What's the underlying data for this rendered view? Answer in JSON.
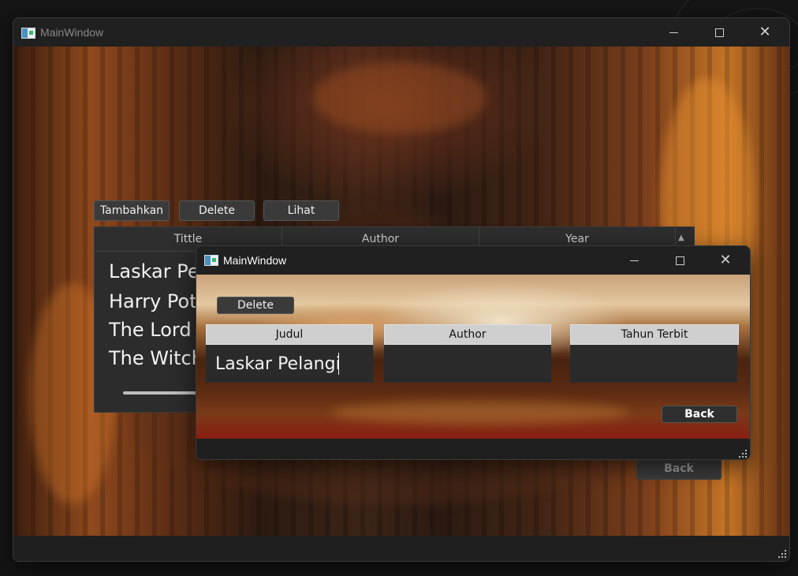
{
  "main_window": {
    "title": "MainWindow",
    "toolbar": {
      "add_label": "Tambahkan",
      "delete_label": "Delete",
      "view_label": "Lihat"
    },
    "table": {
      "headers": [
        "Tittle",
        "Author",
        "Year"
      ],
      "rows": [
        "Laskar Pelangi",
        "Harry Potter",
        "The Lord of the Rings",
        "The Witcher"
      ]
    },
    "back_label": "Back"
  },
  "dialog_window": {
    "title": "MainWindow",
    "delete_label": "Delete",
    "headers": [
      "Judul",
      "Author",
      "Tahun Terbit"
    ],
    "values": {
      "judul": "Laskar Pelangi",
      "author": "",
      "tahun_terbit": ""
    },
    "back_label": "Back"
  },
  "icons": [
    "app-icon",
    "minimize-icon",
    "maximize-icon",
    "close-icon",
    "resize-grip-icon"
  ]
}
